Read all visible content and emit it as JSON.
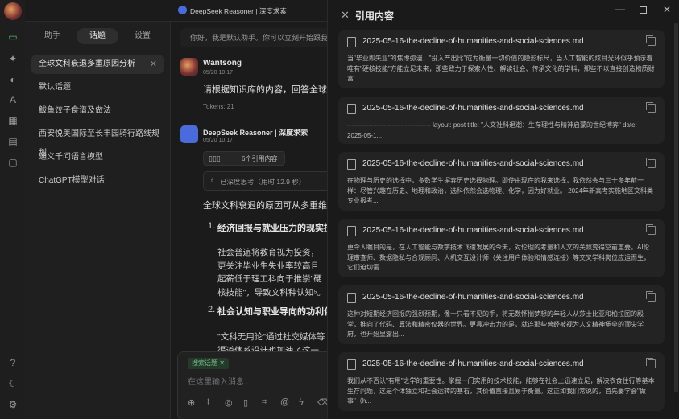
{
  "window": {
    "title": "DeepSeek Reasoner | 深度求索"
  },
  "sidebar_tabs": [
    "助手",
    "话题",
    "设置"
  ],
  "topics": [
    "全球文科衰退多重原因分析",
    "默认话题",
    "鲅鱼饺子食谱及做法",
    "西安悦美国际至长丰园骑行路线规划",
    "通义千问语言模型",
    "ChatGPT模型对话"
  ],
  "chat": {
    "system_prompt": "你好，我是默认助手。你可以立刻开始跟我聊天。",
    "user_name": "Wantsong",
    "user_date": "05/20 10:17",
    "user_message": "请根据知识库的内容，回答全球文科衰退",
    "tokens": "Tokens: 21",
    "bot_name": "DeepSeek Reasoner | 深度求索",
    "bot_date": "05/20 10:17",
    "citations_badge": "6个引用内容",
    "thinking": "已深度思考（用时 12.9 秒）",
    "answer_intro": "全球文科衰退的原因可从多重维度",
    "point1_title": "经济回报与就业压力的现实挤压",
    "point1_body": "社会普遍将教育视为投资，更关注毕业生失业率较高且起薪低于理工科向于推崇\"硬核技能\"，导致文科种认知⁵。",
    "point2_title": "社会认知与职业导向的功利化倾向",
    "point2_body": "\"文科无用论\"通过社交媒体等渠道体系设计也加速了这一趋势，",
    "search_chip": "搜索话题",
    "input_placeholder": "在这里输入消息..."
  },
  "panel": {
    "title": "引用内容",
    "citations": [
      {
        "file": "2025-05-16-the-decline-of-humanities-and-social-sciences.md",
        "text": "当\"毕业即失业\"的焦虑弥漫，\"投入产出比\"成为衡量一切价值的隐形标尺，当人工智能的炫目光环似乎预示着唯有\"硬核技能\"方能立足未来，那些致力于探索人性、解读社会、传承文化的学科，那些不以直接创造物质财富..."
      },
      {
        "file": "2025-05-16-the-decline-of-humanities-and-social-sciences.md",
        "text": "--------------------------------------- layout: post title: \"人文社科退潮：生存理性与精神启蒙的世纪博弈\" date: 2025-05-1..."
      },
      {
        "file": "2025-05-16-the-decline-of-humanities-and-social-sciences.md",
        "text": "在物理与历史的选择中，多数学生摒弃历史选择物理。即使由现在的我来选择，我依然会与三十多年前一样：尽管兴趣在历史、地理和政治，选科依然会选物理、化学，因为好就业。 2024年新高考实施地区文科类专业报考..."
      },
      {
        "file": "2025-05-16-the-decline-of-humanities-and-social-sciences.md",
        "text": "更令人瞩目的是，在人工智能与数字技术飞速发展的今天，对伦理的考量和人文的关照变得空前重要。AI伦理审查师、数据隐私与合规顾问、人机交互设计师（关注用户体验和情感连接）等交叉学科岗位应运而生，它们迫切需..."
      },
      {
        "file": "2025-05-16-the-decline-of-humanities-and-social-sciences.md",
        "text": "这种对短期经济回报的强烈预期，像一只看不见的手，将无数怀揣梦想的年轻人从莎士比亚和柏拉图的殿堂，推向了代码、算法和精密仪器的世界。更具冲击力的是，就连那些曾经被视为人文精神堡垒的顶尖学府，也开始显露出..."
      },
      {
        "file": "2025-05-16-the-decline-of-humanities-and-social-sciences.md",
        "text": "我们从不否认\"有用\"之学的重要性。掌握一门实用的技术技能，能够在社会上迅速立足，解决衣食住行等基本生存问题，这是个体独立和社会运转的基石，其价值直接且易于衡量。这正如我们常说的，首先要学会\"做事\"（h..."
      }
    ]
  },
  "colors": {
    "accent": "#4fb96e",
    "bg": "#1b1b1b",
    "card": "#232323"
  }
}
